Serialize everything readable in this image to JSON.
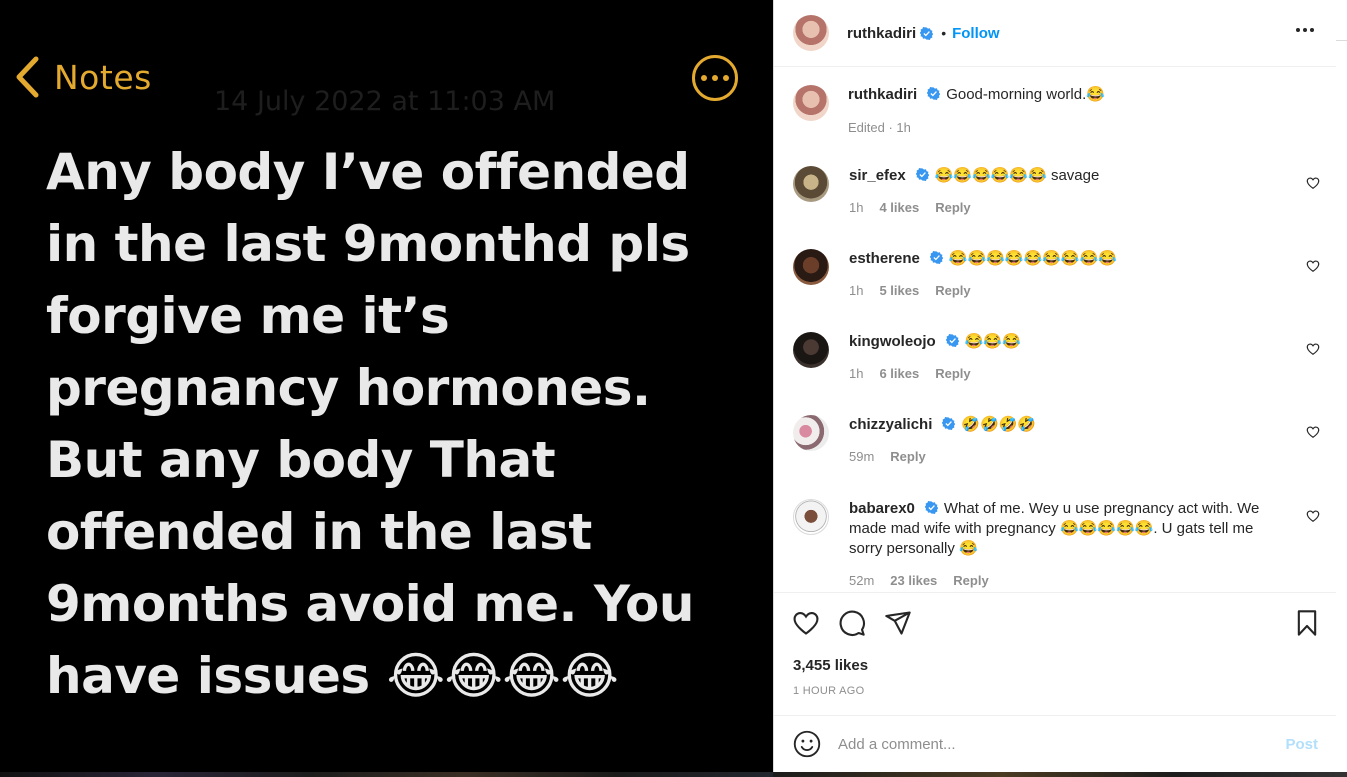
{
  "note": {
    "back_label": "Notes",
    "date": "14 July 2022 at 11:03 AM",
    "body": "Any body I’ve offended in the last 9monthd pls forgive me it’s pregnancy hormones. But any body That offended in the last 9months avoid me. You have issues 😂😂😂😂"
  },
  "post": {
    "username": "ruthkadiri",
    "follow_label": "Follow",
    "dot": "•",
    "caption": "Good-morning world.😂",
    "caption_meta": "Edited · 1h",
    "likes": "3,455 likes",
    "time_ago": "1 HOUR AGO"
  },
  "comments": [
    {
      "user": "sir_efex",
      "text": "😂😂😂😂😂😂 savage",
      "time": "1h",
      "likes": "4 likes",
      "reply": "Reply"
    },
    {
      "user": "estherene",
      "text": "😂😂😂😂😂😂😂😂😂",
      "time": "1h",
      "likes": "5 likes",
      "reply": "Reply"
    },
    {
      "user": "kingwoleojo",
      "text": "😂😂😂",
      "time": "1h",
      "likes": "6 likes",
      "reply": "Reply"
    },
    {
      "user": "chizzyalichi",
      "text": "🤣🤣🤣🤣",
      "time": "59m",
      "likes": "",
      "reply": "Reply"
    },
    {
      "user": "babarex0",
      "text": "What of me. Wey u use pregnancy act with. We made mad wife with pregnancy 😂😂😂😂😂. U gats tell me sorry personally 😂",
      "time": "52m",
      "likes": "23 likes",
      "reply": "Reply"
    }
  ],
  "composer": {
    "placeholder": "Add a comment...",
    "post_label": "Post"
  },
  "colors": {
    "accent_blue": "#0095f6",
    "notes_gold": "#e4aa2f",
    "verified_blue": "#3897f0"
  },
  "icons": [
    "chevron-left-icon",
    "more-circle-icon",
    "verified-icon",
    "more-horizontal-icon",
    "heart-icon",
    "comment-icon",
    "share-icon",
    "bookmark-icon",
    "emoji-icon"
  ]
}
